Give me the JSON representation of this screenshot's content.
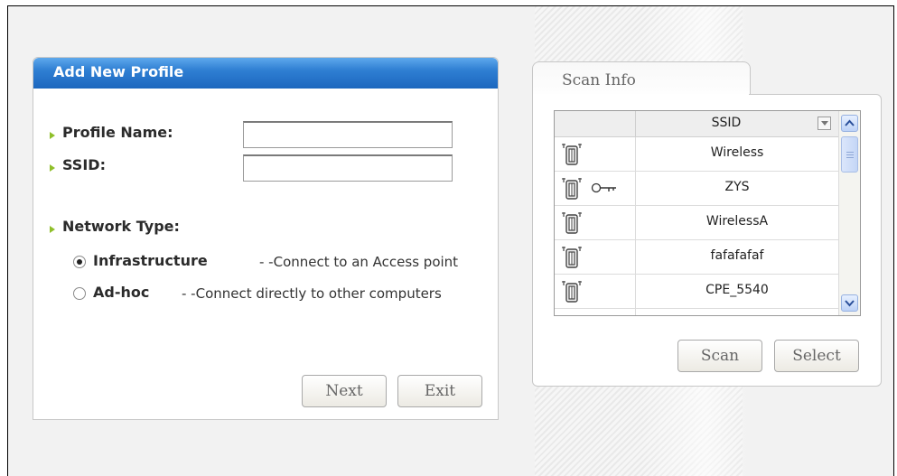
{
  "profile": {
    "title": "Add New Profile",
    "profile_name_label": "Profile Name:",
    "profile_name_value": "",
    "ssid_label": "SSID:",
    "ssid_value": "",
    "network_type_label": "Network Type:",
    "options": [
      {
        "label": "Infrastructure",
        "desc": "- -Connect to an Access point",
        "selected": true
      },
      {
        "label": "Ad-hoc",
        "desc": "- -Connect directly to other computers",
        "selected": false
      }
    ],
    "next_label": "Next",
    "exit_label": "Exit"
  },
  "scan": {
    "tab_label": "Scan Info",
    "column_ssid": "SSID",
    "rows": [
      {
        "ssid": "Wireless",
        "secured": false
      },
      {
        "ssid": "ZYS",
        "secured": true
      },
      {
        "ssid": "WirelessA",
        "secured": false
      },
      {
        "ssid": "fafafafaf",
        "secured": false
      },
      {
        "ssid": "CPE_5540",
        "secured": false
      }
    ],
    "scan_label": "Scan",
    "select_label": "Select"
  },
  "icons": {
    "access_point": "access-point-icon",
    "key": "key-icon",
    "bullet": "bullet-arrow-icon"
  },
  "colors": {
    "header_blue": "#2f7fd3",
    "bullet_green": "#8fbf2a"
  }
}
